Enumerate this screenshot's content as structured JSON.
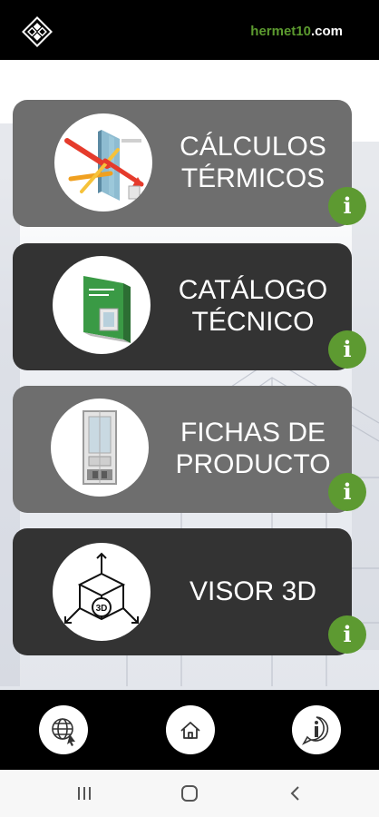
{
  "header": {
    "site_prefix": "hermet10",
    "site_suffix": ".com",
    "logo_icon": "hermet-logo-icon"
  },
  "colors": {
    "accent_green": "#5d9a31",
    "card_grey": "#6e6e6e",
    "card_dark": "#333333",
    "bar_black": "#000000"
  },
  "menu": [
    {
      "line1": "CÁLCULOS",
      "line2": "TÉRMICOS",
      "icon": "window-thermal-icon",
      "info": "i"
    },
    {
      "line1": "CATÁLOGO",
      "line2": "TÉCNICO",
      "icon": "catalog-book-icon",
      "info": "i"
    },
    {
      "line1": "FICHAS DE",
      "line2": "PRODUCTO",
      "icon": "window-profile-icon",
      "info": "i"
    },
    {
      "line1": "VISOR 3D",
      "icon": "cube-3d-icon",
      "badge": "3D",
      "info": "i"
    }
  ],
  "bottom_nav": [
    "globe-icon",
    "home-icon",
    "info-icon"
  ],
  "system_nav": [
    "recents-icon",
    "home-circle-icon",
    "back-icon"
  ]
}
